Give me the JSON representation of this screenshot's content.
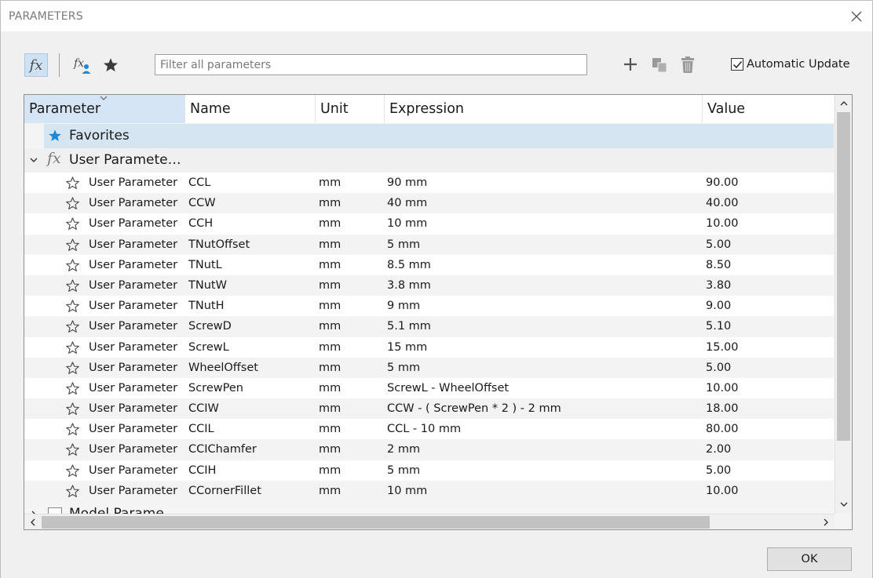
{
  "window": {
    "title": "PARAMETERS"
  },
  "toolbar": {
    "fx_symbol": "fx",
    "filter_placeholder": "Filter all parameters",
    "auto_update_label": "Automatic Update",
    "auto_update_checked": true
  },
  "columns": {
    "parameter": "Parameter",
    "name": "Name",
    "unit": "Unit",
    "expression": "Expression",
    "value": "Value"
  },
  "groups": {
    "favorites": "Favorites",
    "user": "User Paramete…",
    "model": "Model Parame…"
  },
  "rows": [
    {
      "param": "User Parameter",
      "name": "CCL",
      "unit": "mm",
      "expression": "90 mm",
      "value": "90.00"
    },
    {
      "param": "User Parameter",
      "name": "CCW",
      "unit": "mm",
      "expression": "40 mm",
      "value": "40.00"
    },
    {
      "param": "User Parameter",
      "name": "CCH",
      "unit": "mm",
      "expression": "10 mm",
      "value": "10.00"
    },
    {
      "param": "User Parameter",
      "name": "TNutOffset",
      "unit": "mm",
      "expression": "5 mm",
      "value": "5.00"
    },
    {
      "param": "User Parameter",
      "name": "TNutL",
      "unit": "mm",
      "expression": "8.5 mm",
      "value": "8.50"
    },
    {
      "param": "User Parameter",
      "name": "TNutW",
      "unit": "mm",
      "expression": "3.8 mm",
      "value": "3.80"
    },
    {
      "param": "User Parameter",
      "name": "TNutH",
      "unit": "mm",
      "expression": "9 mm",
      "value": "9.00"
    },
    {
      "param": "User Parameter",
      "name": "ScrewD",
      "unit": "mm",
      "expression": "5.1 mm",
      "value": "5.10"
    },
    {
      "param": "User Parameter",
      "name": "ScrewL",
      "unit": "mm",
      "expression": "15 mm",
      "value": "15.00"
    },
    {
      "param": "User Parameter",
      "name": "WheelOffset",
      "unit": "mm",
      "expression": "5 mm",
      "value": "5.00"
    },
    {
      "param": "User Parameter",
      "name": "ScrewPen",
      "unit": "mm",
      "expression": "ScrewL - WheelOffset",
      "value": "10.00"
    },
    {
      "param": "User Parameter",
      "name": "CCIW",
      "unit": "mm",
      "expression": "CCW - ( ScrewPen * 2 ) - 2 mm",
      "value": "18.00"
    },
    {
      "param": "User Parameter",
      "name": "CCIL",
      "unit": "mm",
      "expression": "CCL - 10 mm",
      "value": "80.00"
    },
    {
      "param": "User Parameter",
      "name": "CCIChamfer",
      "unit": "mm",
      "expression": "2 mm",
      "value": "2.00"
    },
    {
      "param": "User Parameter",
      "name": "CCIH",
      "unit": "mm",
      "expression": "5 mm",
      "value": "5.00"
    },
    {
      "param": "User Parameter",
      "name": "CCornerFillet",
      "unit": "mm",
      "expression": "10 mm",
      "value": "10.00"
    }
  ],
  "footer": {
    "ok_label": "OK"
  },
  "colors": {
    "accent": "#1e88d6",
    "selection": "#d5e5f2"
  }
}
